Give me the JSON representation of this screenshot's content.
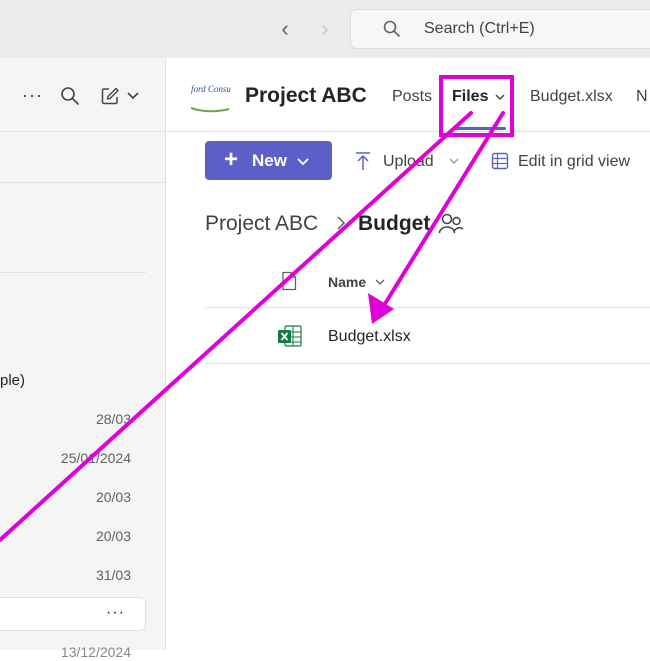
{
  "top_bar": {
    "back_label": "‹",
    "forward_label": "›",
    "search_placeholder": "Search (Ctrl+E)"
  },
  "left_pane": {
    "more_label": "···",
    "partial_item_text": "ple)",
    "dates": [
      "28/03",
      "25/01/2024",
      "20/03",
      "20/03",
      "31/03",
      "13/12/2024"
    ],
    "row_more_label": "···"
  },
  "channel": {
    "logo_text": "ford Consul",
    "title": "Project ABC",
    "tabs": [
      {
        "label": "Posts"
      },
      {
        "label": "Files"
      },
      {
        "label": "Budget.xlsx"
      },
      {
        "label": "N"
      }
    ]
  },
  "toolbar": {
    "new_label": "New",
    "upload_label": "Upload",
    "grid_label": "Edit in grid view"
  },
  "breadcrumb": {
    "root": "Project ABC",
    "current": "Budget"
  },
  "file_list": {
    "column_name": "Name",
    "files": [
      {
        "name": "Budget.xlsx",
        "type": "excel"
      }
    ]
  },
  "colors": {
    "accent": "#5b5fc7",
    "annotation": "#e000d8",
    "excel_green": "#107c41"
  }
}
